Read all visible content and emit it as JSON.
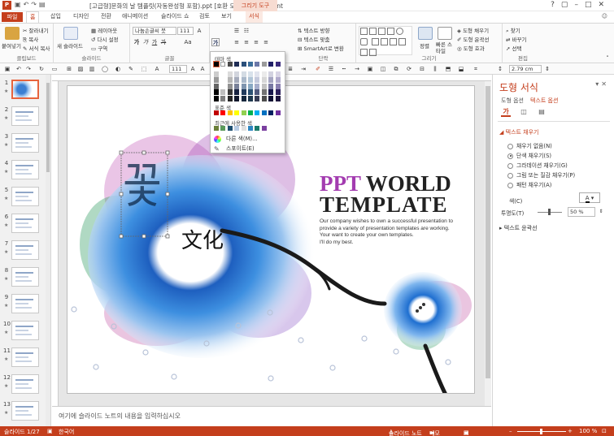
{
  "window": {
    "title": "[고급형]문화의 날 템플릿(자동완성형 포함).ppt [호환 모드] - PowerPoint",
    "context_title": "그리기 도구",
    "app_logo": "P",
    "qat_icons": [
      "save-icon",
      "undo-icon",
      "redo-icon",
      "slideshow-icon"
    ],
    "win_buttons": [
      "?",
      "▢",
      "–",
      "□",
      "✕"
    ]
  },
  "tabs": [
    "파일",
    "홈",
    "삽입",
    "디자인",
    "전환",
    "애니메이션",
    "슬라이드 쇼",
    "검토",
    "보기",
    "서식"
  ],
  "active_tab": "홈",
  "ribbon": {
    "clipboard": {
      "paste": "붙여넣기",
      "cut": "잘라내기",
      "copy": "복사",
      "format_painter": "서식 복사",
      "label": "클립보드"
    },
    "slides": {
      "new_slide": "새 슬라이드",
      "layout": "레이아웃",
      "reset": "다시 설정",
      "section": "구역",
      "label": "슬라이드"
    },
    "font": {
      "name": "나눔손글씨 붓",
      "size": "111",
      "grow": "A",
      "shrink": "A",
      "clear": "Aa",
      "label": "글꼴",
      "bold": "가",
      "italic": "가",
      "underline": "가",
      "strike": "가"
    },
    "paragraph": {
      "text_direction": "텍스트 방향",
      "align_text": "텍스트 맞춤",
      "smartart": "SmartArt로 변환",
      "label": "단락"
    },
    "drawing": {
      "arrange": "정렬",
      "quick_styles": "빠른 스타일",
      "shape_fill": "도형 채우기",
      "shape_outline": "도형 윤곽선",
      "shape_effects": "도형 효과",
      "label": "그리기"
    },
    "editing": {
      "find": "찾기",
      "replace": "바꾸기",
      "select": "선택",
      "label": "편집"
    }
  },
  "toolbar2": {
    "font_size": "111",
    "width": "2.79 cm"
  },
  "color_menu": {
    "theme_header": "테마 색",
    "standard_header": "표준 색",
    "recent_header": "최근에 사용한 색",
    "more_colors": "다른 색(M)...",
    "eyedropper": "스포이트(E)",
    "theme_colors": [
      "#000000",
      "#ffffff",
      "#4a4a4a",
      "#1f2d55",
      "#2a4f7a",
      "#3b6f9b",
      "#6b78a8",
      "#9a9a9a",
      "#202066",
      "#3a2a7c"
    ],
    "standard_colors": [
      "#c00000",
      "#ff0000",
      "#ffc000",
      "#ffff00",
      "#92d050",
      "#00b050",
      "#00b0f0",
      "#0070c0",
      "#002060",
      "#7030a0"
    ],
    "recent_colors": [
      "#6b7f3a",
      "#5a9a5a",
      "#1e4f6f",
      "#b8cce4",
      "#e0e0e0",
      "#2e86c1",
      "#1a7a6a",
      "#7b3fa0"
    ]
  },
  "thumbnails": [
    "1",
    "2",
    "3",
    "4",
    "5",
    "6",
    "7",
    "8",
    "9",
    "10",
    "11",
    "12",
    "13"
  ],
  "selected_slide": "1",
  "slide": {
    "title_ppt": "PPT",
    "title_world": "WORLD",
    "title_template": "TEMPLATE",
    "body_text": [
      "Our company wishes to own a successful presentation to",
      "provide a variety of presentation templates are working.",
      "Your want to create your own templates.",
      "I'll do my best."
    ],
    "calligraphy_flower": "꽃",
    "calligraphy_culture": "文化"
  },
  "notes_placeholder": "여기에 슬라이드 노트의 내용을 입력하십시오",
  "format_pane": {
    "title": "도형 서식",
    "tab_shape": "도형 옵션",
    "tab_text": "텍스트 옵션",
    "text_fill_section": "텍스트 채우기",
    "fill_options": [
      "채우기 없음(N)",
      "단색 채우기(S)",
      "그라데이션 채우기(G)",
      "그림 또는 질감 채우기(P)",
      "패턴 채우기(A)"
    ],
    "selected_fill": "단색 채우기(S)",
    "color_label": "색(C)",
    "transparency_label": "투명도(T)",
    "transparency_value": "50 %",
    "text_outline_section": "텍스트 윤곽선"
  },
  "status": {
    "slide": "슬라이드 1/27",
    "language": "한국어",
    "notes": "슬라이드 노트",
    "comments": "메모",
    "zoom": "100 %"
  },
  "accent": "#c43e1c"
}
